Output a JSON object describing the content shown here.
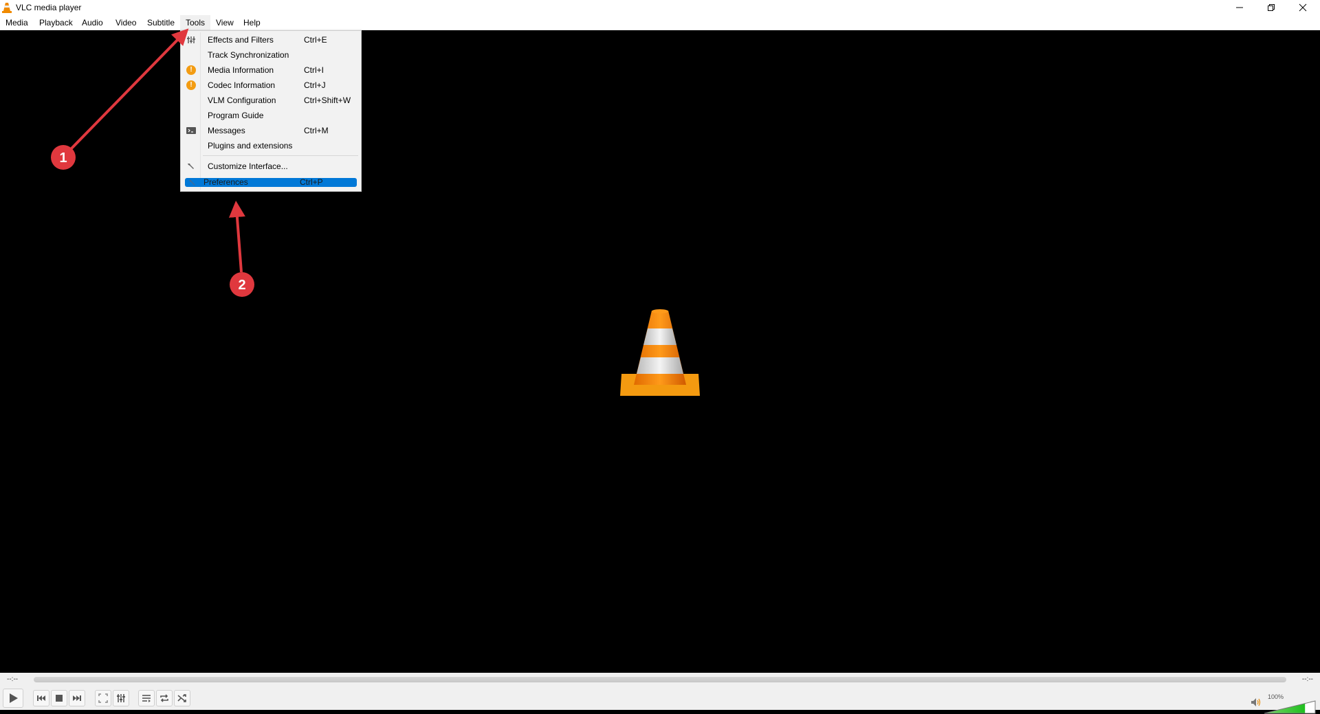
{
  "window": {
    "title": "VLC media player",
    "controls": [
      "minimize",
      "restore",
      "close"
    ]
  },
  "menubar": {
    "items": [
      {
        "label": "Media"
      },
      {
        "label": "Playback"
      },
      {
        "label": "Audio"
      },
      {
        "label": "Video"
      },
      {
        "label": "Subtitle"
      },
      {
        "label": "Tools",
        "active": true
      },
      {
        "label": "View"
      },
      {
        "label": "Help"
      }
    ]
  },
  "tools_menu": {
    "items": [
      {
        "label": "Effects and Filters",
        "shortcut": "Ctrl+E",
        "icon": "equalizer-icon"
      },
      {
        "label": "Track Synchronization",
        "shortcut": "",
        "icon": ""
      },
      {
        "label": "Media Information",
        "shortcut": "Ctrl+I",
        "icon": "info-icon"
      },
      {
        "label": "Codec Information",
        "shortcut": "Ctrl+J",
        "icon": "info-icon"
      },
      {
        "label": "VLM Configuration",
        "shortcut": "Ctrl+Shift+W",
        "icon": ""
      },
      {
        "label": "Program Guide",
        "shortcut": "",
        "icon": ""
      },
      {
        "label": "Messages",
        "shortcut": "Ctrl+M",
        "icon": "terminal-icon"
      },
      {
        "label": "Plugins and extensions",
        "shortcut": "",
        "icon": ""
      },
      {
        "label": "Customize Interface...",
        "shortcut": "",
        "icon": "wrench-icon"
      },
      {
        "label": "Preferences",
        "shortcut": "Ctrl+P",
        "icon": "wrench-icon",
        "highlighted": true
      }
    ]
  },
  "controls": {
    "time_elapsed": "--:--",
    "time_remaining": "--:--",
    "volume_label": "100%",
    "volume_fraction": 0.8
  },
  "annotations": [
    {
      "number": "1",
      "target": "Tools menu"
    },
    {
      "number": "2",
      "target": "Preferences"
    }
  ],
  "colors": {
    "highlight": "#0078d7",
    "annotation": "#e0383e",
    "cone": "#f08a00"
  }
}
